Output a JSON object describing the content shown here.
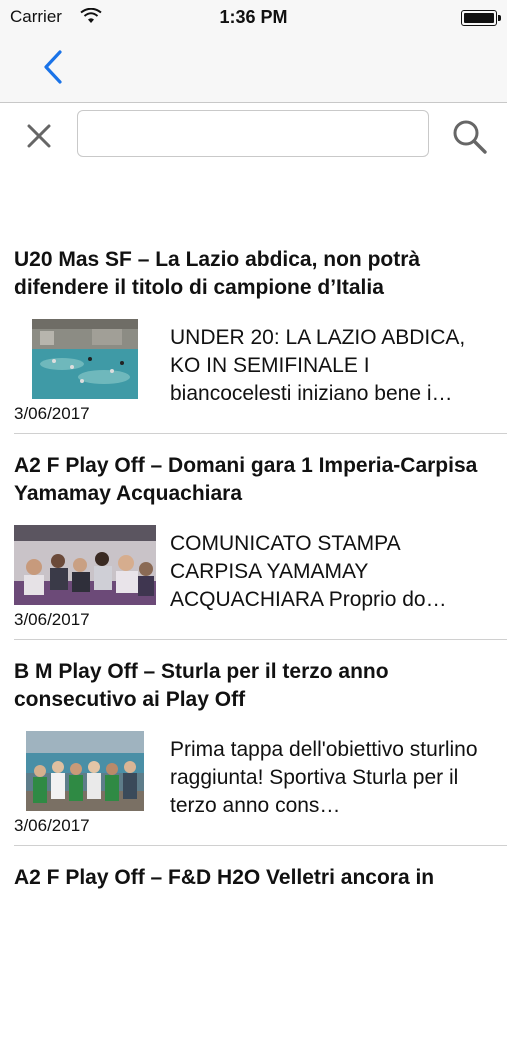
{
  "status_bar": {
    "carrier": "Carrier",
    "time": "1:36 PM"
  },
  "nav": {
    "back_icon": "chevron-left-icon",
    "accent_color": "#1a73e8"
  },
  "search": {
    "clear_icon": "close-icon",
    "value": "",
    "placeholder": "",
    "search_icon": "search-icon"
  },
  "articles": [
    {
      "title": "U20 Mas SF – La Lazio abdica, non potrà difendere il titolo di campione d’Italia",
      "summary": "UNDER 20: LA LAZIO ABDICA, KO IN SEMIFINALE I biancocelesti iniziano bene i…",
      "date": "3/06/2017",
      "thumbnail": "pool-match-photo"
    },
    {
      "title": "A2 F Play Off – Domani gara 1 Imperia-Carpisa Yamamay Acquachiara",
      "summary": "COMUNICATO STAMPA CARPISA YAMAMAY ACQUACHIARA Proprio do…",
      "date": "3/06/2017",
      "thumbnail": "team-bus-photo"
    },
    {
      "title": "B M Play Off – Sturla per il terzo anno consecutivo ai Play Off",
      "summary": "Prima tappa dell'obiettivo sturlino raggiunta! Sportiva Sturla per il terzo anno cons…",
      "date": "3/06/2017",
      "thumbnail": "team-group-photo"
    },
    {
      "title": "A2 F Play Off – F&D H2O Velletri ancora in",
      "summary": "",
      "date": "",
      "thumbnail": ""
    }
  ]
}
